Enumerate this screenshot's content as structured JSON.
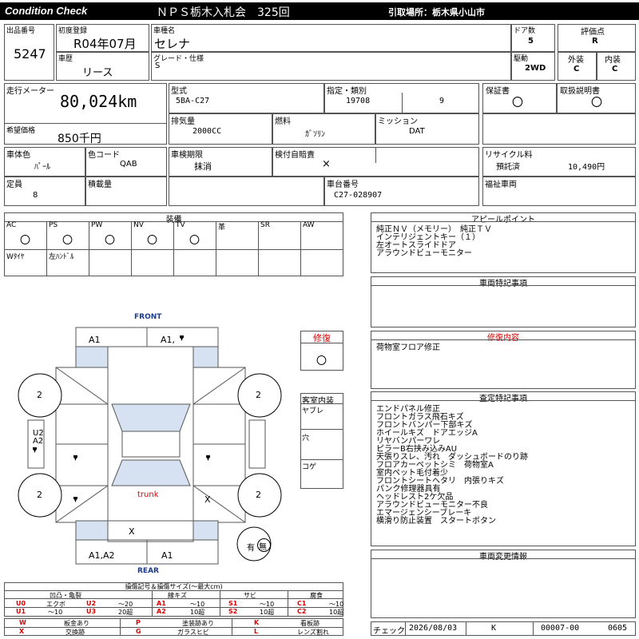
{
  "header": {
    "left_title": "Condition Check",
    "center_title": "ＮＰＳ栃木入札会　325回",
    "pickup": "引取場所：栃木県小山市"
  },
  "labels": {
    "lot": "出品番号",
    "first_reg": "初度登録",
    "car_name": "車種名",
    "doors": "ドア数",
    "rating": "評価点",
    "history": "車歴",
    "grade": "グレード・仕様",
    "drive": "駆動",
    "exterior": "外装",
    "interior": "内装",
    "mileage": "走行メーター",
    "model": "型式",
    "designation": "指定・類別",
    "warranty": "保証書",
    "manual": "取扱説明書",
    "desired": "希望価格",
    "displacement": "排気量",
    "fuel": "燃料",
    "mission": "ミッション",
    "color": "車体色",
    "color_code": "色コード",
    "inspection": "車検期限",
    "insurance": "検付自賠責",
    "recycle": "リサイクル料",
    "capacity": "定員",
    "load": "積載量",
    "chassis": "車台番号",
    "welfare": "福祉車両",
    "equip": "装備",
    "appeal": "アピールポイント",
    "special": "車両特記事項",
    "repair_content": "修復内容",
    "assess": "査定特記事項",
    "change": "車両変更情報",
    "repair": "修復",
    "cabin": "客室内装",
    "check": "チェック"
  },
  "values": {
    "lot": "5247",
    "first_reg": "R04年07月",
    "car_name": "セレナ",
    "doors": "5",
    "rating": "R",
    "history": "リース",
    "grade": "S",
    "drive": "2WD",
    "exterior": "C",
    "interior": "C",
    "mileage": "80,024km",
    "model": "5BA-C27",
    "designation": "19708",
    "class_no": "9",
    "warranty": "〇",
    "manual": "〇",
    "desired": "850千円",
    "displacement": "2000CC",
    "fuel": "ｶﾞｿﾘﾝ",
    "mission": "DAT",
    "color": "ﾊﾟｰﾙ",
    "color_code": "QAB",
    "inspection": "抹消",
    "insurance": "×",
    "recycle_status": "預託済",
    "recycle_amount": "10,490円",
    "capacity": "8",
    "chassis": "C27-028907",
    "repair": "〇"
  },
  "equipment": {
    "items": [
      {
        "label": "AC",
        "mark": "〇"
      },
      {
        "label": "PS",
        "mark": "〇"
      },
      {
        "label": "PW",
        "mark": "〇"
      },
      {
        "label": "NV",
        "mark": "〇"
      },
      {
        "label": "TV",
        "mark": "〇"
      },
      {
        "label": "革",
        "mark": ""
      },
      {
        "label": "SR",
        "mark": ""
      },
      {
        "label": "AW",
        "mark": ""
      }
    ],
    "row2": [
      "Wﾀｲﾔ",
      "左ﾊﾝﾄﾞﾙ"
    ]
  },
  "appeal_lines": [
    "純正ＮＶ（メモリー）　純正ＴＶ",
    "インテリジェントキー（１）",
    "左オートスライドドア",
    "アラウンドビューモニター"
  ],
  "repair_lines": [
    "荷物室フロア修正"
  ],
  "assess_lines": [
    "エンドパネル修正",
    "フロントガラス飛石キズ",
    "フロントバンパー下部キズ",
    "ホイールキズ　ドアエッジA",
    "リヤバンパーワレ",
    "ピラーB右挟み込みAU",
    "天張りスレ、汚れ　ダッシュボードのり跡",
    "フロアカーペットシミ　荷物室A",
    "室内ペット毛付着少",
    "フロントシートヘタリ　内張りキズ",
    "パンク修理器具有",
    "ヘッドレスト2ケ欠品",
    "アラウンドビューモニター不良",
    "エマージェンシーブレーキ",
    "横滑り防止装置　スタートボタン"
  ],
  "cabin_items": [
    "ヤブレ",
    "穴",
    "コゲ"
  ],
  "diagram": {
    "front": "FRONT",
    "rear": "REAR",
    "trunk": "trunk",
    "marks": {
      "front_left": "A1",
      "front_right": "A1,",
      "tire_fl": "2",
      "tire_fr": "2",
      "tire_rl": "2",
      "tire_rr": "2",
      "mirror_left": "U2\nA2",
      "rear_right_panel": "X",
      "rear_bumper": "X",
      "rear_left": "A1,A2",
      "rear_right": "A1"
    },
    "smoke": "有",
    "smoke2": "無"
  },
  "legend": {
    "title": "損傷記号＆損傷サイズ(～最大cm)",
    "headers": [
      "凹凸・亀裂",
      "線キズ",
      "サビ",
      "腐食"
    ],
    "row1": [
      [
        "U0",
        "エクボ"
      ],
      [
        "U2",
        "～20"
      ],
      [
        "A1",
        "～10"
      ],
      [
        "S1",
        "～10"
      ],
      [
        "C1",
        "～10"
      ]
    ],
    "row2": [
      [
        "U1",
        "～10"
      ],
      [
        "U3",
        "20超"
      ],
      [
        "A2",
        "10超"
      ],
      [
        "S2",
        "10超"
      ],
      [
        "C2",
        "10超"
      ]
    ],
    "row3": [
      [
        "W",
        "板金あり"
      ],
      [
        "P",
        "塗装跡あり"
      ],
      [
        "K",
        "看板跡"
      ]
    ],
    "row4": [
      [
        "X",
        "交換跡"
      ],
      [
        "G",
        "ガラスヒビ"
      ],
      [
        "L",
        "レンズ割れ"
      ]
    ]
  },
  "footer": {
    "date": "2026/08/03",
    "code": "K",
    "number": "00007-00",
    "num2": "0605"
  },
  "colors": {
    "header_bg": "#000000",
    "panel_shade": "#d6e2f2",
    "front_text": "#1a3a8c",
    "repair_red": "#d00000"
  }
}
